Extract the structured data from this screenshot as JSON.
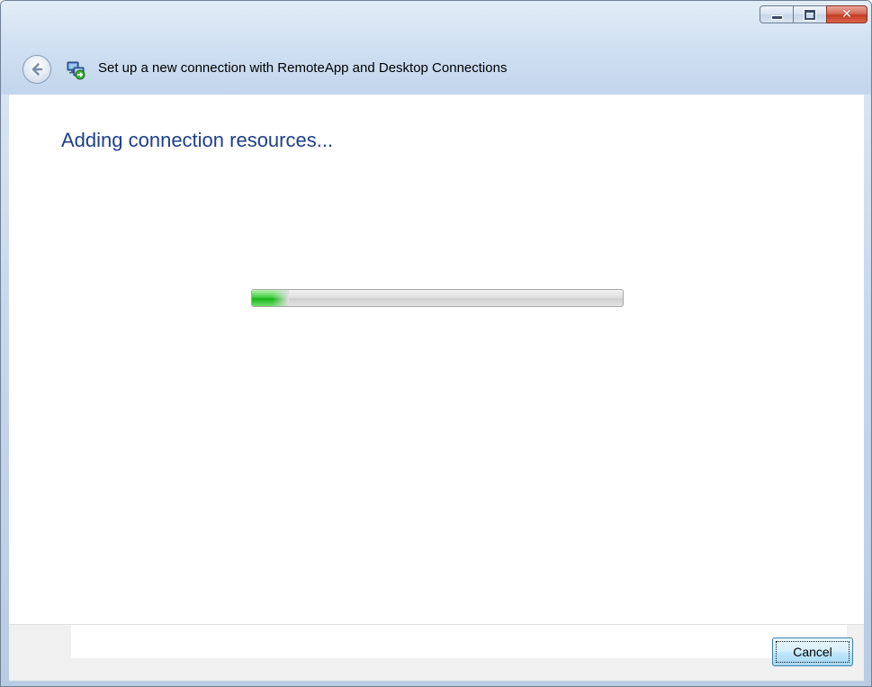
{
  "window": {
    "title": "Set up a new connection with RemoteApp and Desktop Connections",
    "icons": {
      "back": "back-arrow-icon",
      "app": "remoteapp-connection-icon",
      "minimize": "minimize-icon",
      "maximize": "maximize-icon",
      "close": "close-icon"
    },
    "close_glyph": "✕"
  },
  "main": {
    "heading": "Adding connection resources...",
    "progress": {
      "fraction": 0.1,
      "color": "#1fb51f"
    }
  },
  "footer": {
    "cancel_label": "Cancel"
  }
}
